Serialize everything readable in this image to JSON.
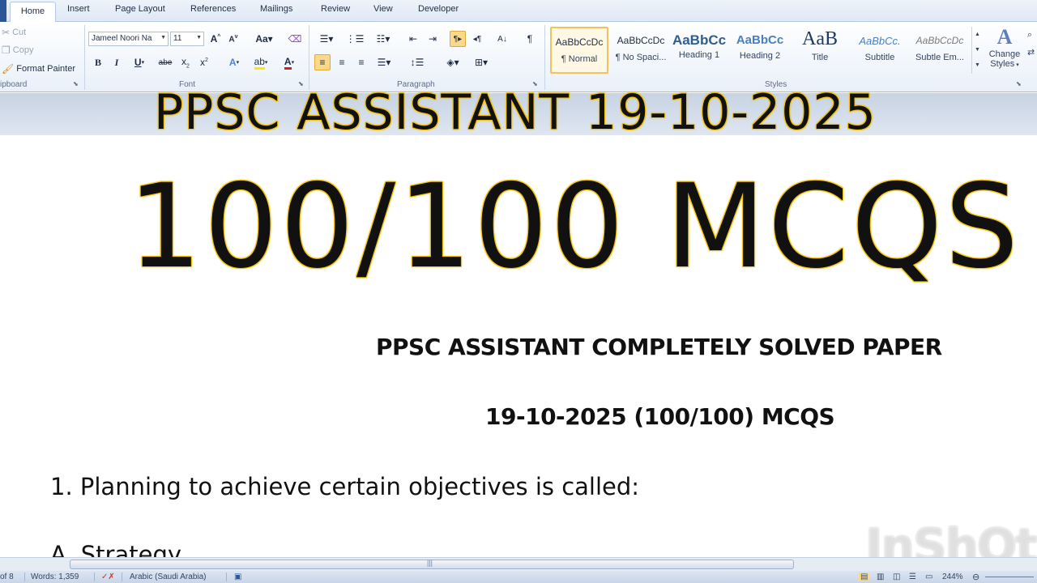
{
  "ribbon": {
    "tabs": [
      "Home",
      "Insert",
      "Page Layout",
      "References",
      "Mailings",
      "Review",
      "View",
      "Developer"
    ],
    "clipboard": {
      "cut": "Cut",
      "copy": "Copy",
      "format_painter": "Format Painter",
      "group_label": "ipboard"
    },
    "font": {
      "font_name": "Jameel Noori Na",
      "font_size": "11",
      "group_label": "Font"
    },
    "paragraph": {
      "group_label": "Paragraph"
    },
    "styles": {
      "group_label": "Styles",
      "items": [
        {
          "sample": "AaBbCcDc",
          "name": "¶ Normal"
        },
        {
          "sample": "AaBbCcDc",
          "name": "¶ No Spaci..."
        },
        {
          "sample": "AaBbCc",
          "name": "Heading 1"
        },
        {
          "sample": "AaBbCc",
          "name": "Heading 2"
        },
        {
          "sample": "AaB",
          "name": "Title"
        },
        {
          "sample": "AaBbCc.",
          "name": "Subtitle"
        },
        {
          "sample": "AaBbCcDc",
          "name": "Subtle Em..."
        }
      ],
      "change_styles_line1": "Change",
      "change_styles_line2": "Styles"
    }
  },
  "overlay": {
    "line1": "PPSC ASSISTANT 19-10-2025",
    "line2": "100/100 MCQS"
  },
  "document": {
    "heading1": "PPSC ASSISTANT COMPLETELY SOLVED PAPER",
    "heading2": "19-10-2025 (100/100) MCQS",
    "question1": "1. Planning to achieve certain objectives is called:",
    "option_a": "A. Strategy"
  },
  "watermark": "InShOt",
  "status_bar": {
    "page": "of 8",
    "words": "Words: 1,359",
    "language": "Arabic (Saudi Arabia)",
    "zoom": "244%"
  },
  "colors": {
    "overlay_outline": "#f2c20d",
    "ribbon_bg": "#e9f0f9",
    "selected_style": "#f4c15a"
  }
}
